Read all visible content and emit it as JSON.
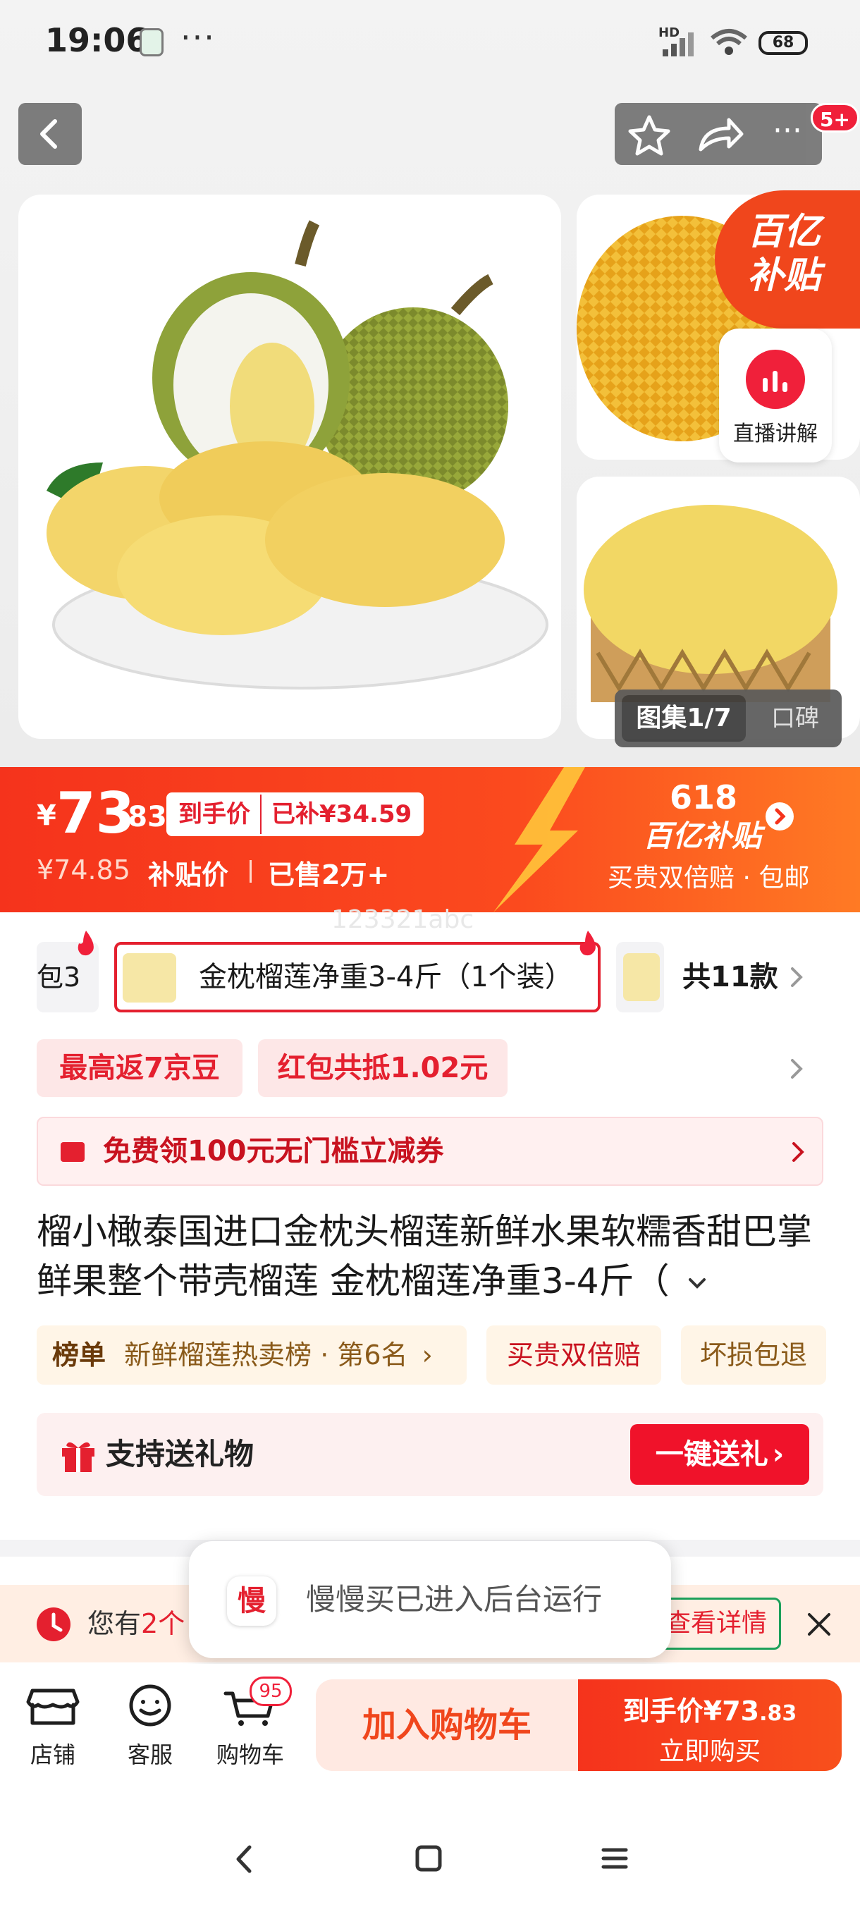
{
  "status_bar": {
    "time": "19:06",
    "dots": "···",
    "network_label": "HD",
    "battery": "68"
  },
  "header": {
    "more_badge": "5+"
  },
  "gallery": {
    "subsidy_line1": "百亿",
    "subsidy_line2": "补贴",
    "live_label": "直播讲解",
    "tab_gallery": "图集1/7",
    "tab_reviews": "口碑"
  },
  "price": {
    "currency": "¥",
    "integer": "73",
    "decimal": ".83",
    "final_label": "到手价",
    "subsidy_amount": "已补¥34.59",
    "original": "¥74.85",
    "subsidy_price_label": "补贴价",
    "sold": "已售2万+",
    "event": "618",
    "event_brand": "百亿补贴",
    "guarantee": "买贵双倍赔 · 包邮",
    "watermark": "123321abc"
  },
  "variants": {
    "prev_partial": "包3",
    "selected": "金枕榴莲净重3-4斤（1个装）",
    "total": "共11款"
  },
  "promos": {
    "beans": "最高返7京豆",
    "redpacket": "红包共抵1.02元"
  },
  "coupon": {
    "text": "免费领100元无门槛立减券"
  },
  "product": {
    "title": "榴小橄泰国进口金枕头榴莲新鲜水果软糯香甜巴掌鲜果整个带壳榴莲 金枕榴莲净重3-4斤（"
  },
  "tags": {
    "rank_label": "榜单",
    "rank_text": "新鲜榴莲热卖榜 · 第6名",
    "double_pay": "买贵双倍赔",
    "damage": "坏损包退"
  },
  "gift": {
    "label": "支持送礼物",
    "button": "一键送礼"
  },
  "notice": {
    "prefix": "您有",
    "count": "2个",
    "button": "查看详情"
  },
  "toast": {
    "app_icon_char": "慢",
    "message": "慢慢买已进入后台运行"
  },
  "bottom": {
    "store": "店铺",
    "service": "客服",
    "cart": "购物车",
    "cart_badge": "95",
    "add_cart": "加入购物车",
    "buy_price_label": "到手价",
    "buy_price_currency": "¥",
    "buy_price_int": "73",
    "buy_price_dec": ".83",
    "buy_now": "立即购买"
  },
  "colors": {
    "accent": "#f5331c",
    "red": "#e4202f",
    "gold": "#8a5a1a"
  }
}
